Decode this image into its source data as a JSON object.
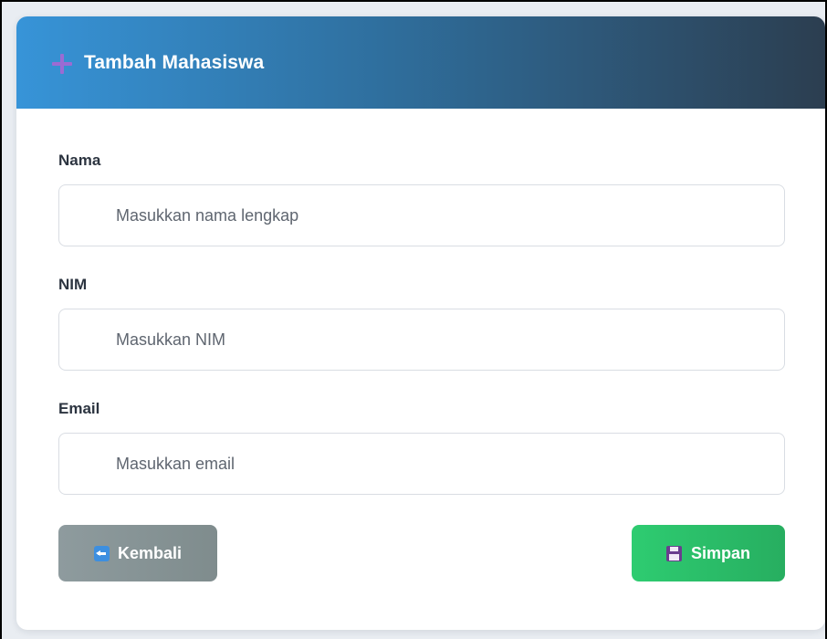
{
  "header": {
    "title": "Tambah Mahasiswa",
    "icon": "plus-icon"
  },
  "form": {
    "fields": [
      {
        "label": "Nama",
        "placeholder": "Masukkan nama lengkap",
        "value": ""
      },
      {
        "label": "NIM",
        "placeholder": "Masukkan NIM",
        "value": ""
      },
      {
        "label": "Email",
        "placeholder": "Masukkan email",
        "value": ""
      }
    ]
  },
  "actions": {
    "back_label": "Kembali",
    "back_icon": "back-arrow-icon",
    "save_label": "Simpan",
    "save_icon": "floppy-disk-icon"
  },
  "colors": {
    "header_start": "#3794d8",
    "header_end": "#2c3e50",
    "back_button": "#7f8c8d",
    "save_button": "#2ecc71",
    "accent_icon": "#9b6bd3"
  }
}
